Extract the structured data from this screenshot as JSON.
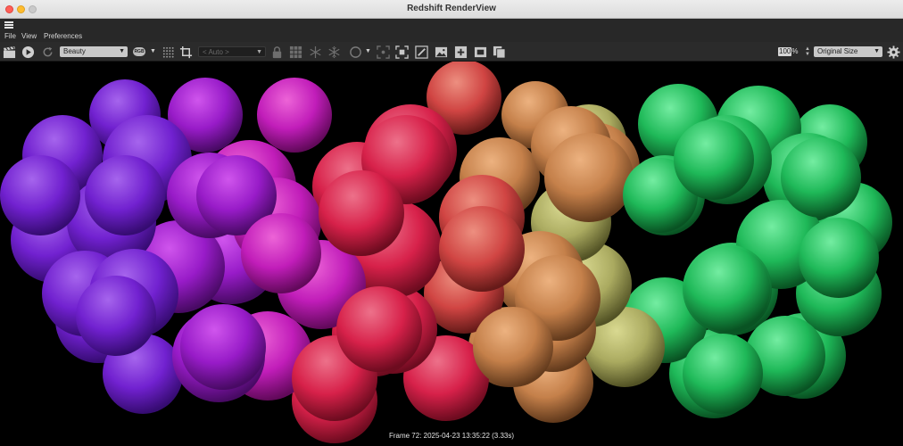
{
  "window": {
    "title": "Redshift RenderView"
  },
  "menu": {
    "items": [
      "File",
      "View",
      "Preferences"
    ]
  },
  "toolbar": {
    "aov_select": "Beauty",
    "rgb_label": "RGB",
    "camera_select": "< Auto >",
    "zoom_value": "100",
    "zoom_unit": "%",
    "size_select": "Original Size"
  },
  "icons": {
    "hamburger": "menu-icon",
    "clapper": "clapperboard-icon",
    "play": "play-icon",
    "refresh": "refresh-icon",
    "crop": "crop-icon",
    "lock": "lock-icon",
    "grid": "grid-icon",
    "snowflake": "snowflake-icon",
    "gear": "gear-icon"
  },
  "status": {
    "frame_text": "Frame  72:  2025-04-23  13:35:22  (3.33s)"
  },
  "colors": {
    "purple": "#7a24e0",
    "magenta": "#d020c8",
    "red": "#e82450",
    "orange": "#d48a50",
    "yellow_green": "#b8b868",
    "green": "#22c860"
  }
}
